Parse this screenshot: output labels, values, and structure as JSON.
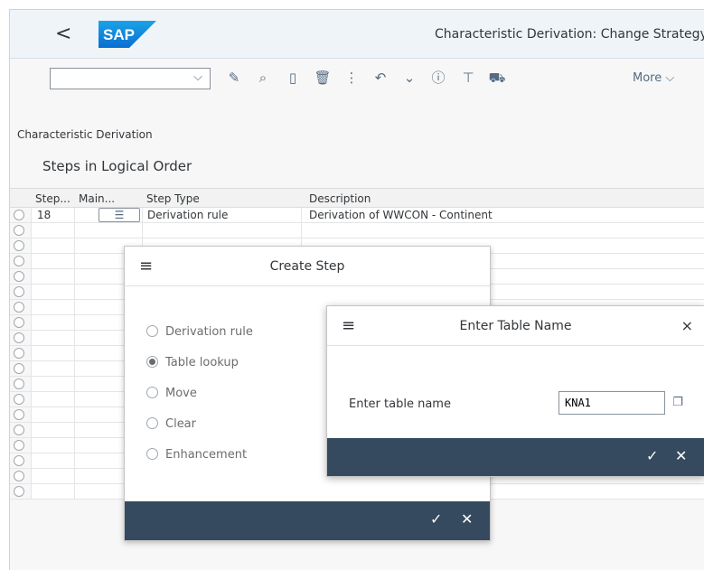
{
  "shell": {
    "back_label": "<",
    "logo_text": "SAP",
    "title": "Characteristic Derivation: Change Strategy"
  },
  "toolbar": {
    "combo_value": "",
    "more_label": "More",
    "icons": [
      "edit-glasses-icon",
      "search-icon",
      "new-document-icon",
      "delete-icon",
      "insert-icon",
      "undo-icon",
      "expand-all-icon",
      "info-icon",
      "filter-icon",
      "transport-icon"
    ]
  },
  "breadcrumb": "Characteristic Derivation",
  "section_title": "Steps in Logical Order",
  "table": {
    "headers": [
      "Step...",
      "Main...",
      "Step Type",
      "Description"
    ],
    "rows": [
      {
        "step": "18",
        "step_type": "Derivation rule",
        "description": "Derivation of WWCON - Continent"
      }
    ],
    "empty_rows": 18
  },
  "create_step": {
    "title": "Create Step",
    "options": [
      {
        "label": "Derivation rule",
        "selected": false
      },
      {
        "label": "Table lookup",
        "selected": true
      },
      {
        "label": "Move",
        "selected": false
      },
      {
        "label": "Clear",
        "selected": false
      },
      {
        "label": "Enhancement",
        "selected": false
      }
    ],
    "ok_icon": "checkmark-icon",
    "cancel_icon": "cancel-icon"
  },
  "enter_table": {
    "title": "Enter Table Name",
    "field_label": "Enter table name",
    "field_value": "KNA1",
    "close_label": "×"
  }
}
